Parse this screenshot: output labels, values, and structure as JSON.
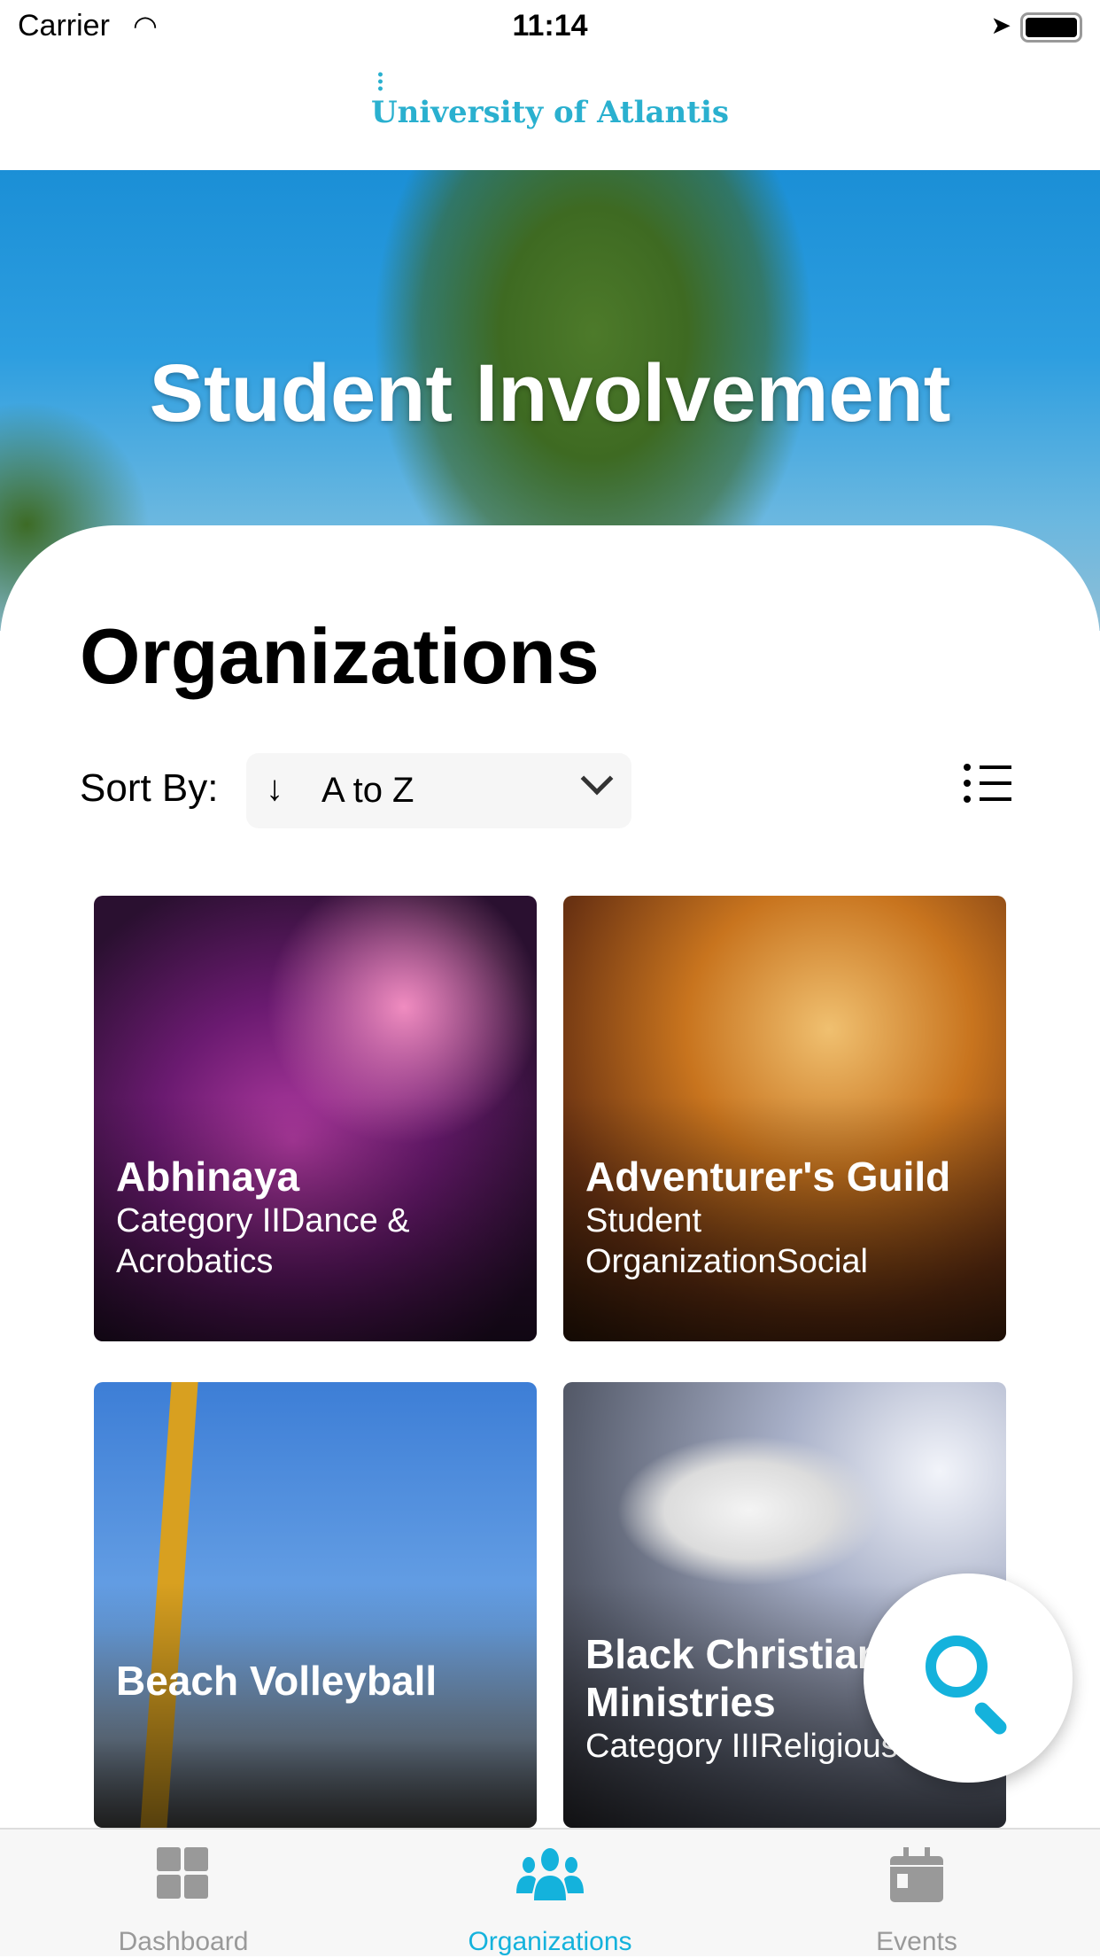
{
  "status_bar": {
    "carrier": "Carrier",
    "time": "11:14"
  },
  "header": {
    "logo_text": "University of Atlantis"
  },
  "hero": {
    "title": "Student Involvement"
  },
  "main": {
    "title": "Organizations",
    "sort_label": "Sort By:",
    "sort_value": "A to Z",
    "sort_direction_icon": "↓"
  },
  "cards": [
    {
      "name": "Abhinaya",
      "subtitle": "Category IIDance & Acrobatics"
    },
    {
      "name": "Adventurer's Guild",
      "subtitle": "Student OrganizationSocial"
    },
    {
      "name": "Beach Volleyball",
      "subtitle": ""
    },
    {
      "name": "Black Christian Ministries",
      "subtitle": "Category IIIReligious"
    }
  ],
  "tabs": [
    {
      "label": "Dashboard",
      "icon": "grid-icon"
    },
    {
      "label": "Organizations",
      "icon": "people-icon",
      "active": true
    },
    {
      "label": "Events",
      "icon": "calendar-icon"
    }
  ],
  "colors": {
    "accent": "#14b2dc",
    "inactive": "#999999"
  }
}
